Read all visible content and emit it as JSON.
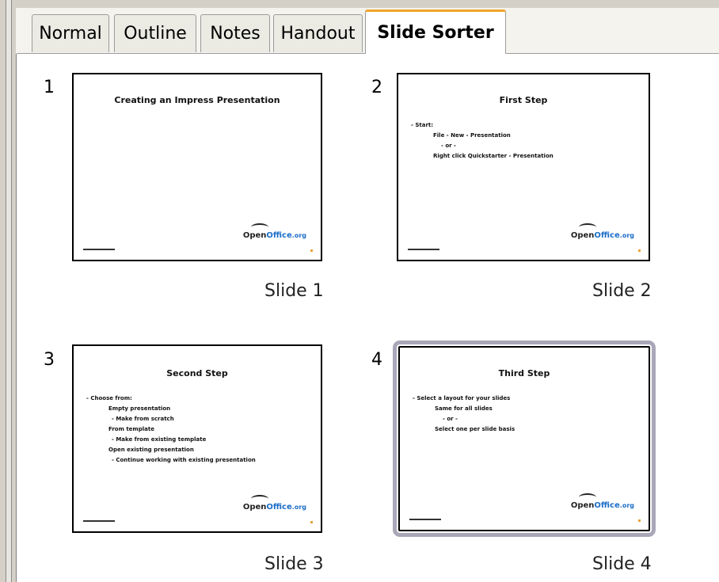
{
  "tabs": [
    {
      "label": "Normal"
    },
    {
      "label": "Outline"
    },
    {
      "label": "Notes"
    },
    {
      "label": "Handout"
    },
    {
      "label": "Slide Sorter"
    }
  ],
  "active_tab": "Slide Sorter",
  "slides": [
    {
      "number": "1",
      "caption": "Slide 1",
      "title": "Creating an Impress Presentation",
      "bullets": []
    },
    {
      "number": "2",
      "caption": "Slide 2",
      "title": "First Step",
      "bullets": [
        {
          "level": 1,
          "text": "Start:"
        },
        {
          "level": 2,
          "text": "File - New - Presentation"
        },
        {
          "level": "or",
          "text": "- or -"
        },
        {
          "level": 2,
          "text": "Right click Quickstarter - Presentation"
        }
      ]
    },
    {
      "number": "3",
      "caption": "Slide 3",
      "title": "Second Step",
      "bullets": [
        {
          "level": 1,
          "text": "Choose from:"
        },
        {
          "level": 2,
          "text": "Empty presentation"
        },
        {
          "level": 3,
          "text": "Make from scratch"
        },
        {
          "level": 2,
          "text": "From template"
        },
        {
          "level": 3,
          "text": "Make from existing template"
        },
        {
          "level": 2,
          "text": "Open existing presentation"
        },
        {
          "level": 3,
          "text": "Continue working with existing presentation"
        }
      ]
    },
    {
      "number": "4",
      "caption": "Slide 4",
      "title": "Third Step",
      "selected": true,
      "bullets": [
        {
          "level": 1,
          "text": "Select a layout for your slides"
        },
        {
          "level": 2,
          "text": "Same for all slides"
        },
        {
          "level": "or",
          "text": "- or -"
        },
        {
          "level": 2,
          "text": "Select one per slide basis"
        }
      ]
    }
  ],
  "logo": {
    "part1": "Open",
    "part2": "Office",
    "suffix": ".org"
  },
  "colors": {
    "active_tab_accent": "#f2a42a",
    "selection_outline": "#a9a7b8",
    "logo_blue": "#1d6fc9"
  }
}
